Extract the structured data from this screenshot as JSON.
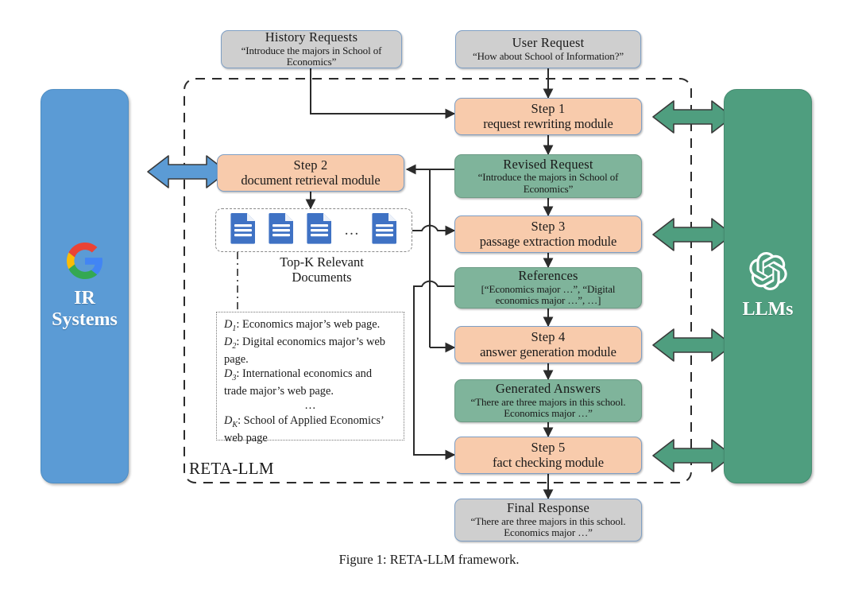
{
  "figure": {
    "caption": "Figure 1: RETA-LLM framework.",
    "boundary_label": "RETA-LLM"
  },
  "panels": {
    "left": {
      "name": "IR Systems",
      "label_line1": "IR",
      "label_line2": "Systems",
      "logo": "google-g-logo",
      "color": "#5b9bd5"
    },
    "right": {
      "name": "LLMs",
      "label_line1": "LLMs",
      "label_line2": "",
      "logo": "openai-logo",
      "color": "#4f9e7f"
    }
  },
  "nodes": {
    "history_requests": {
      "title": "History Requests",
      "sub": "“Introduce the majors in School of Economics”",
      "kind": "io"
    },
    "user_request": {
      "title": "User Request",
      "sub": "“How about School of Information?”",
      "kind": "io"
    },
    "step1": {
      "title": "Step 1",
      "sub": "request rewriting module",
      "kind": "step"
    },
    "step2": {
      "title": "Step 2",
      "sub": "document retrieval module",
      "kind": "step"
    },
    "step3": {
      "title": "Step 3",
      "sub": "passage extraction module",
      "kind": "step"
    },
    "step4": {
      "title": "Step 4",
      "sub": "answer generation module",
      "kind": "step"
    },
    "step5": {
      "title": "Step 5",
      "sub": "fact checking module",
      "kind": "step"
    },
    "revised_request": {
      "title": "Revised Request",
      "sub": "“Introduce the majors in School of Economics”",
      "kind": "data"
    },
    "references": {
      "title": "References",
      "sub": "[“Economics major …”, “Digital economics major …”, …]",
      "kind": "data"
    },
    "generated_answers": {
      "title": "Generated Answers",
      "sub": "“There are three majors in this school. Economics major …”",
      "kind": "data"
    },
    "final_response": {
      "title": "Final Response",
      "sub": "“There are three majors in this school. Economics major …”",
      "kind": "io"
    }
  },
  "documents": {
    "bay_label_line1": "Top-K Relevant",
    "bay_label_line2": "Documents",
    "icon_count": 4,
    "ellipsis": "…",
    "list": [
      {
        "key": "D",
        "sub": "1",
        "text": ": Economics major’s web page."
      },
      {
        "key": "D",
        "sub": "2",
        "text": ": Digital economics major’s web page."
      },
      {
        "key": "D",
        "sub": "3",
        "text": ": International economics and trade major’s web page."
      },
      {
        "key": "",
        "sub": "",
        "text": "…"
      },
      {
        "key": "D",
        "sub": "K",
        "text": ": School of Applied Economics’ web page"
      }
    ]
  },
  "colors": {
    "step_fill": "#f8cbac",
    "data_fill": "#7fb49b",
    "io_fill": "#cfcfcf",
    "ir_panel": "#5b9bd5",
    "llm_panel": "#4f9e7f",
    "arrow_left": "#4f8ec4",
    "arrow_right": "#4f9e7f",
    "doc_icon": "#3f72c4",
    "wire": "#2b2b2b"
  },
  "connectors": {
    "bidirectional_arrows_right_count": 4,
    "bidirectional_arrows_left_count": 1
  }
}
